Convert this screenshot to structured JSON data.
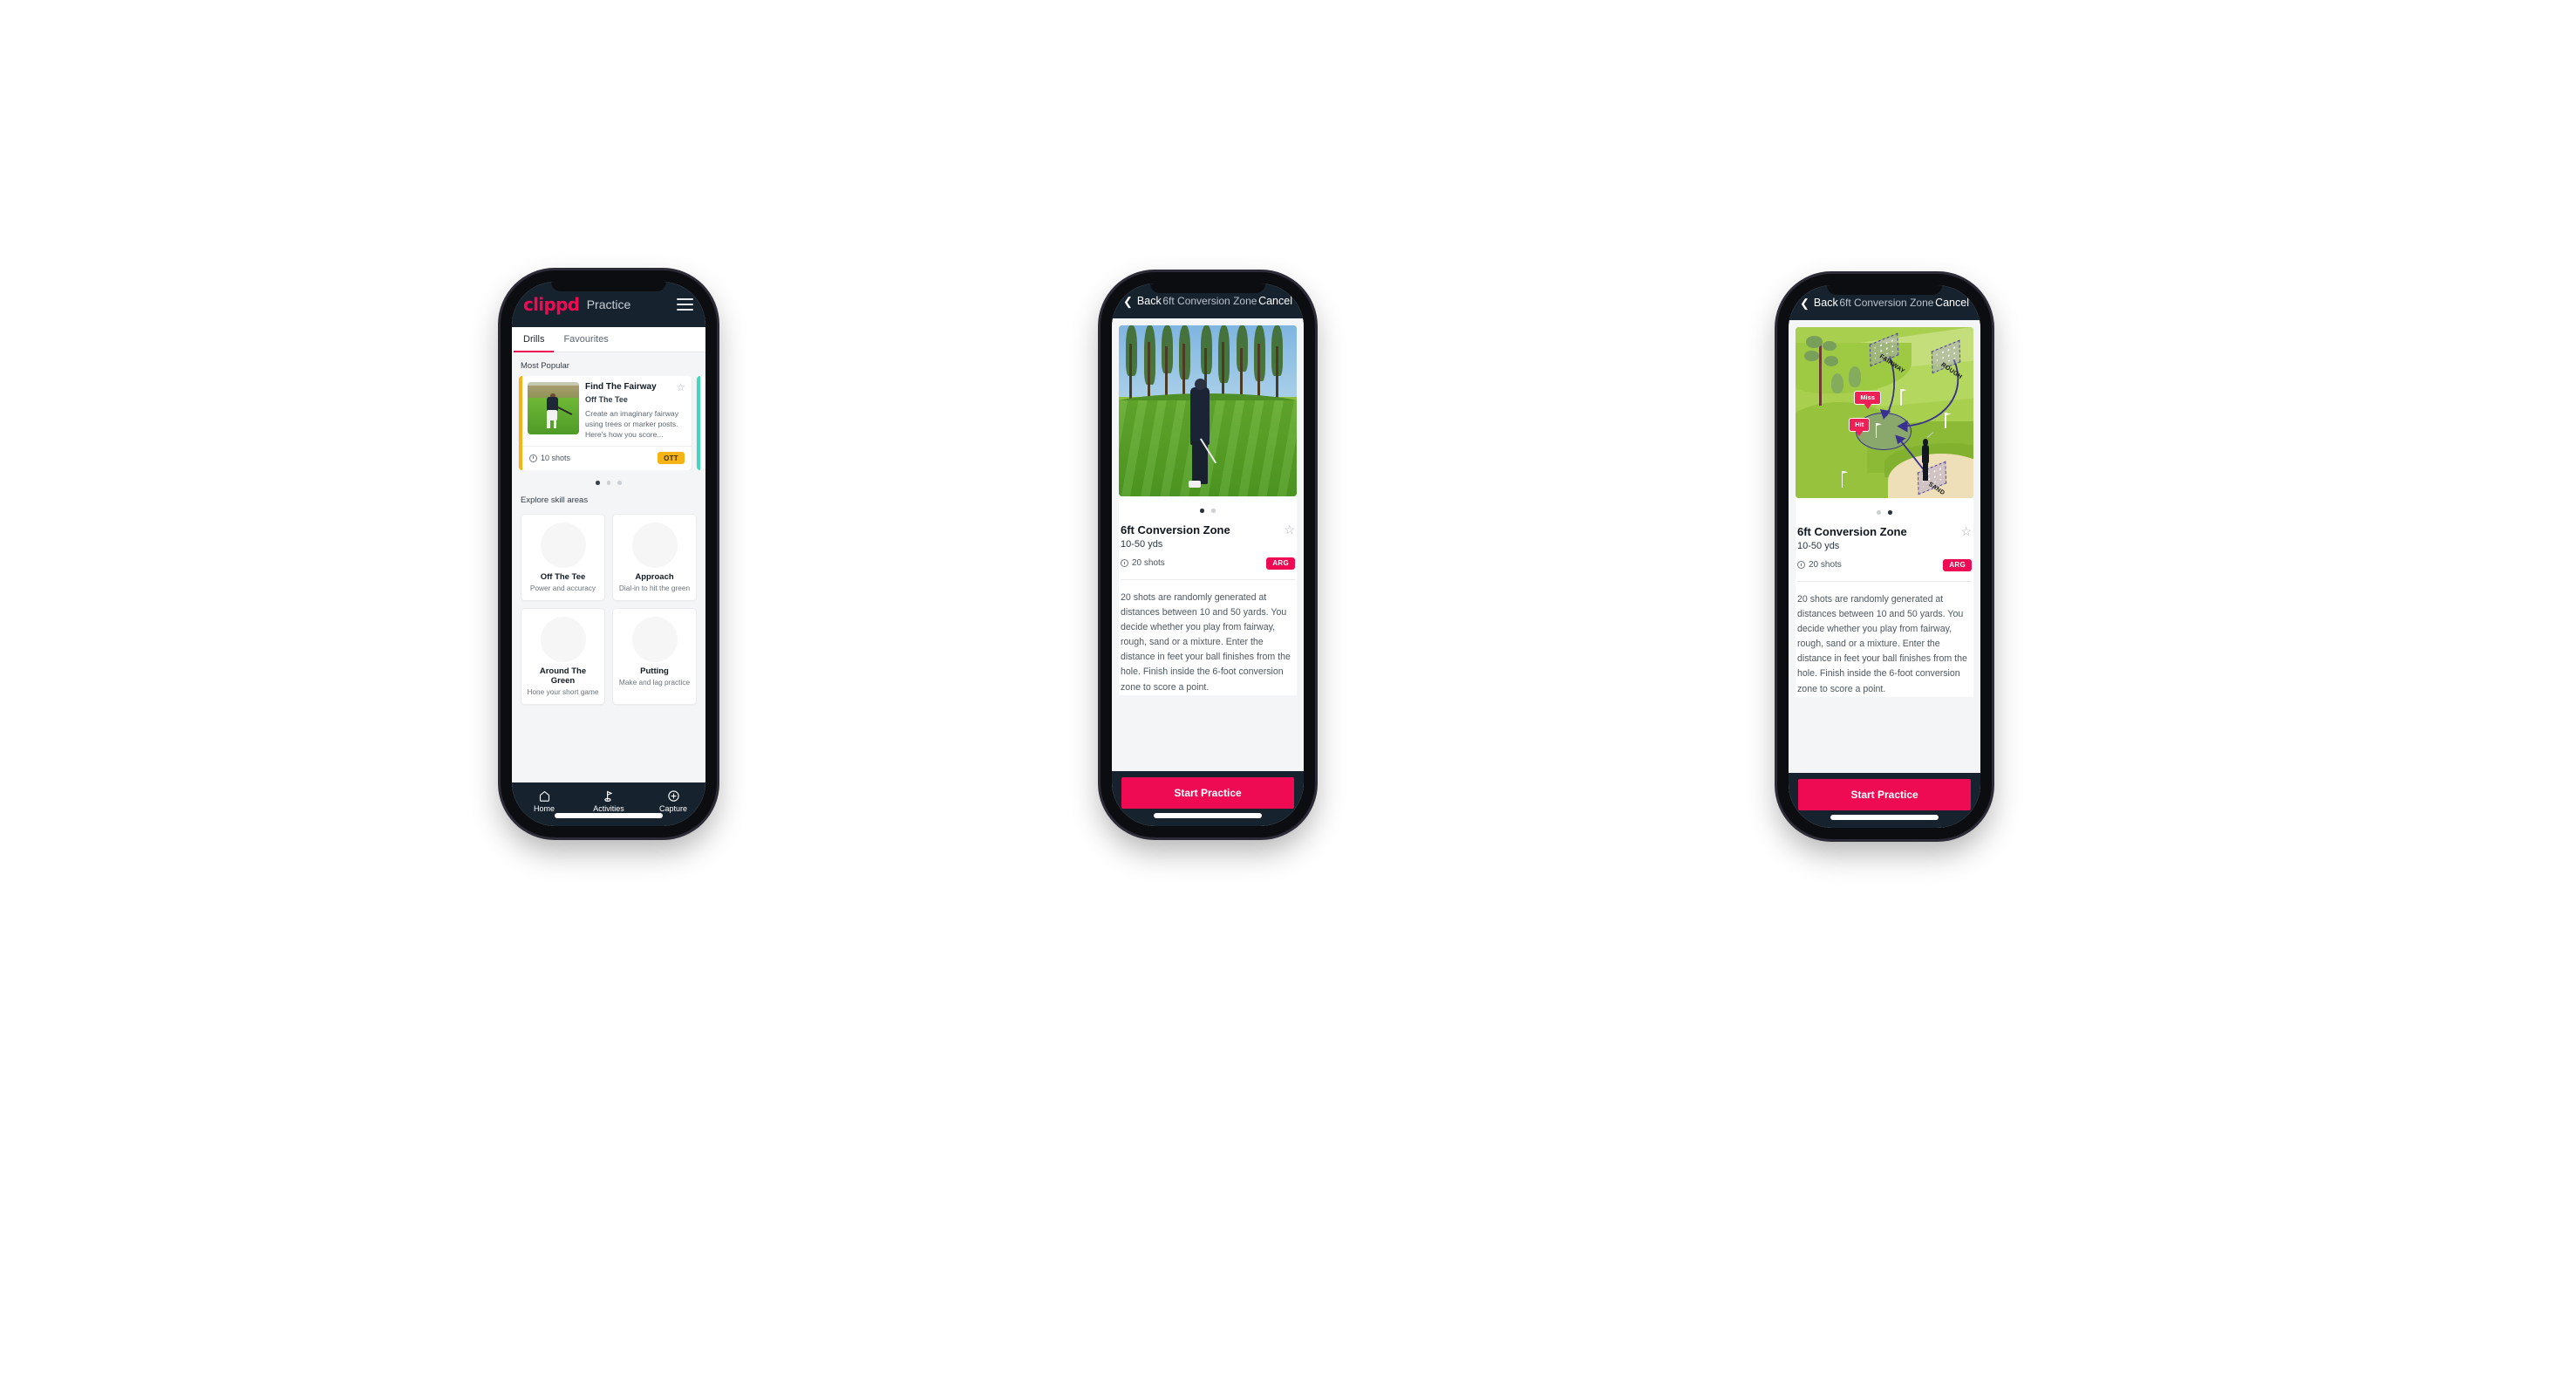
{
  "phone1": {
    "appbar": {
      "brand": "clippd",
      "title": "Practice",
      "menu_icon": "hamburger-menu-icon"
    },
    "tabs": [
      {
        "label": "Drills",
        "active": true
      },
      {
        "label": "Favourites",
        "active": false
      }
    ],
    "sections": {
      "most_popular": "Most Popular",
      "explore": "Explore skill areas"
    },
    "featured_drill": {
      "title": "Find The Fairway",
      "subtitle": "Off The Tee",
      "description": "Create an imaginary fairway using trees or marker posts. Here's how you score...",
      "shots": "10 shots",
      "tag": "OTT",
      "tag_color": "#f5b316",
      "accent_color": "#f5b316",
      "next_accent_color": "#3fd9bd",
      "favourite_icon": "star-outline-icon",
      "shots_icon": "clock-icon"
    },
    "carousel_dots": {
      "count": 3,
      "active": 0
    },
    "skill_areas": [
      {
        "name": "Off The Tee",
        "desc": "Power and accuracy",
        "icon": "tee-fan-icon",
        "accent": "#f5b316"
      },
      {
        "name": "Approach",
        "desc": "Dial-in to hit the green",
        "icon": "approach-green-icon",
        "accent": "#2fd4b5"
      },
      {
        "name": "Around The Green",
        "desc": "Hone your short game",
        "icon": "around-green-icon",
        "accent": "#ef2a63"
      },
      {
        "name": "Putting",
        "desc": "Make and lag practice",
        "icon": "putting-rings-icon",
        "accent": "#9b29d6"
      }
    ],
    "tabbar": [
      {
        "label": "Home",
        "icon": "home-icon",
        "active": false
      },
      {
        "label": "Activities",
        "icon": "golf-flag-icon",
        "active": true
      },
      {
        "label": "Capture",
        "icon": "plus-circle-icon",
        "active": false
      }
    ]
  },
  "detail": {
    "navbar": {
      "back": "Back",
      "title": "6ft Conversion Zone",
      "cancel": "Cancel",
      "back_icon": "chevron-left-icon"
    },
    "title": "6ft Conversion Zone",
    "yards": "10-50 yds",
    "shots": "20 shots",
    "tag": "ARG",
    "tag_color": "#ef0b53",
    "favourite_icon": "star-outline-icon",
    "shots_icon": "clock-icon",
    "description": "20 shots are randomly generated at distances between 10 and 50 yards. You decide whether you play from fairway, rough, sand or a mixture. Enter the distance in feet your ball finishes from the hole. Finish inside the 6-foot conversion zone to score a point.",
    "cta": "Start Practice"
  },
  "phone2": {
    "media_type": "photo",
    "media_name": "golf-chip-shot-photo",
    "dots": {
      "count": 2,
      "active": 0
    }
  },
  "phone3": {
    "media_type": "illustration",
    "media_name": "golf-course-diagram-illustration",
    "dots": {
      "count": 2,
      "active": 1
    },
    "illustration_labels": {
      "fairway": "FAIRWAY",
      "rough": "ROUGH",
      "sand": "SAND",
      "miss": "Miss",
      "hit": "Hit"
    }
  },
  "theme": {
    "brand_pink": "#ef0b53",
    "navy": "#16222e",
    "page_bg": "#f4f5f6",
    "teal": "#3fd9bd",
    "amber": "#f5b316"
  }
}
